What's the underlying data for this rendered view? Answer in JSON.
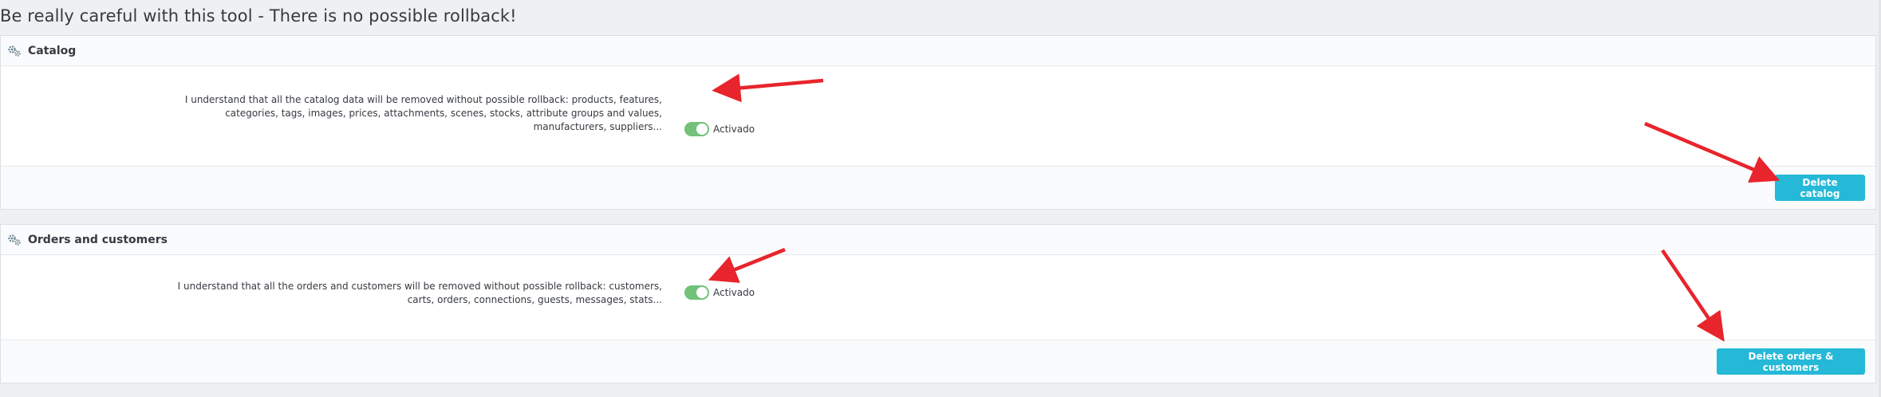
{
  "page": {
    "warning": "Be really careful with this tool - There is no possible rollback!"
  },
  "catalog": {
    "heading": "Catalog",
    "icon": "cogs-icon",
    "description": "I understand that all the catalog data will be removed without possible rollback: products, features, categories, tags, images, prices, attachments, scenes, stocks, attribute groups and values, manufacturers, suppliers...",
    "switch_label": "Activado",
    "switch_on": true,
    "button_label": "Delete catalog"
  },
  "orders": {
    "heading": "Orders and customers",
    "icon": "cogs-icon",
    "description": "I understand that all the orders and customers will be removed without possible rollback: customers, carts, orders, connections, guests, messages, stats...",
    "switch_label": "Activado",
    "switch_on": true,
    "button_label": "Delete orders & customers"
  },
  "colors": {
    "accent": "#25b9d7",
    "toggle_on": "#72c279",
    "annotation_arrow": "#e8242c"
  }
}
